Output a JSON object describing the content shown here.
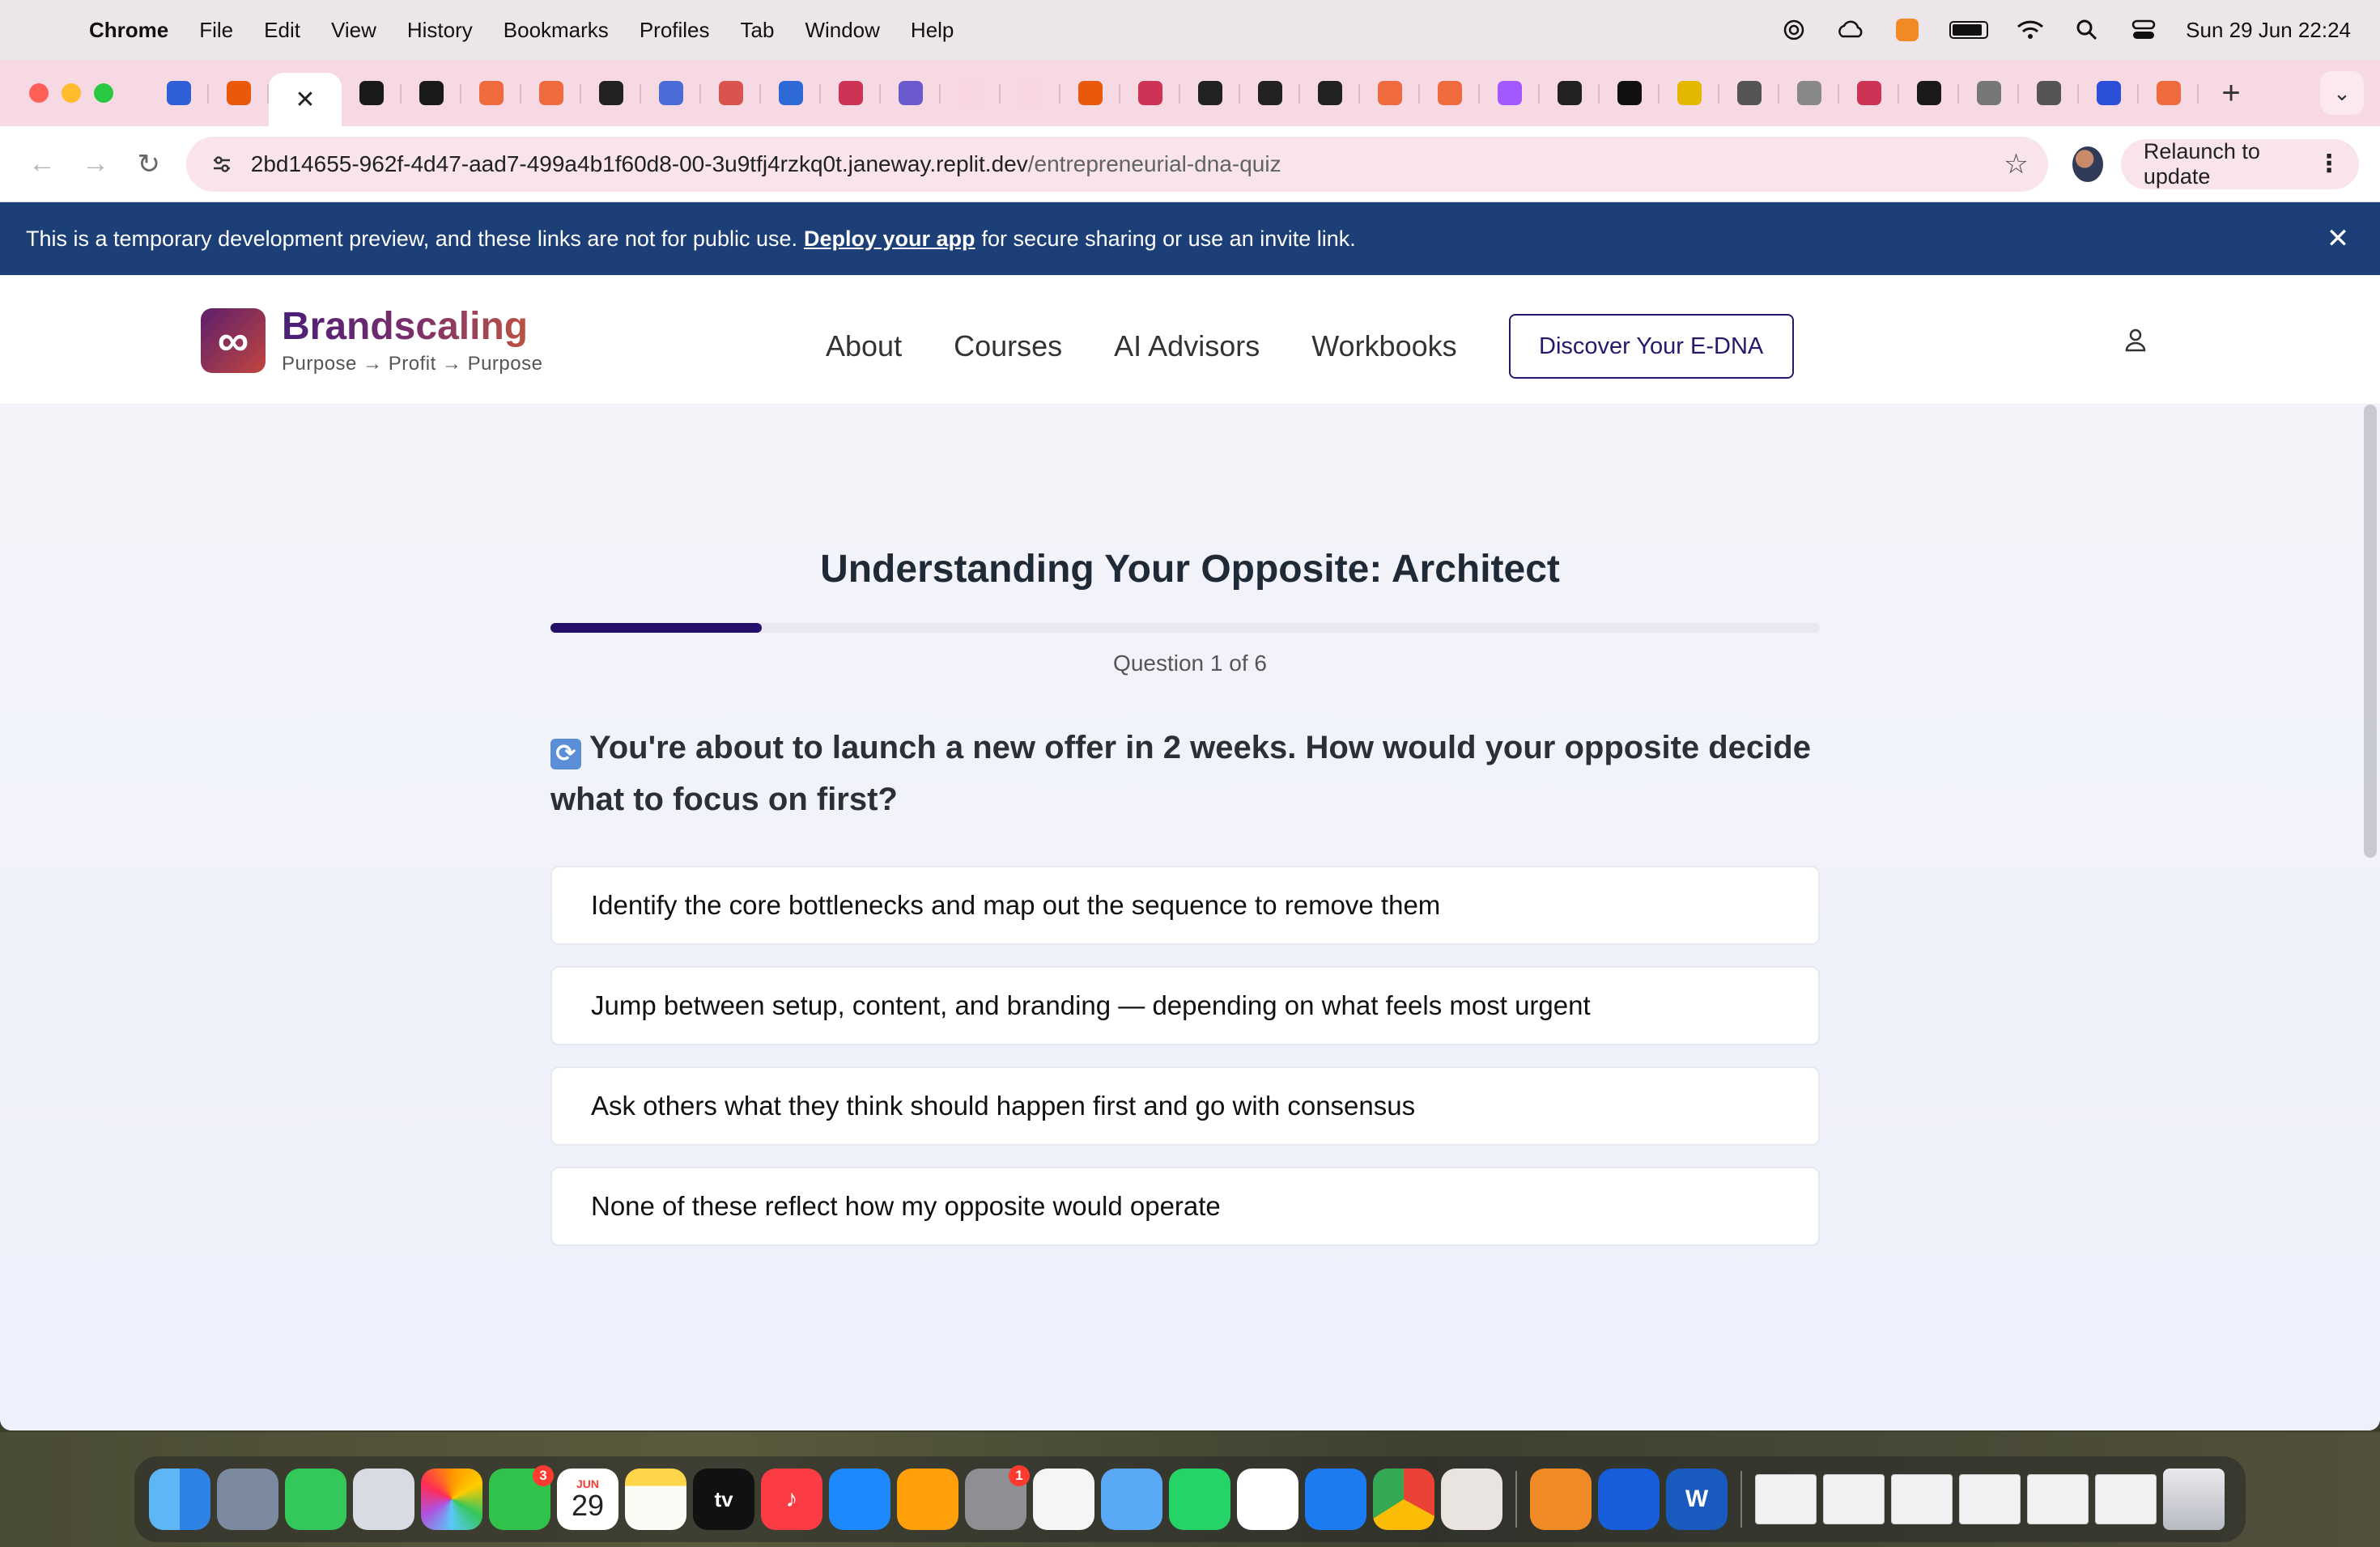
{
  "menubar": {
    "app": "Chrome",
    "items": [
      "File",
      "Edit",
      "View",
      "History",
      "Bookmarks",
      "Profiles",
      "Tab",
      "Window",
      "Help"
    ],
    "clock": "Sun 29 Jun  22:24"
  },
  "tabs": {
    "favicon_colors": [
      "#2f5fd6",
      "#e8590c",
      "#1a1a1a",
      "#1a1a1a",
      "#ef6a3c",
      "#ef6a3c",
      "#222222",
      "#4b6bd6",
      "#d9534f",
      "#2d6ad6",
      "#cc3355",
      "#6a5acd",
      "#f8d7e0",
      "#f8d7e0",
      "#e8590c",
      "#cc3355",
      "#222222",
      "#222222",
      "#222222",
      "#ef6a3c",
      "#ef6a3c",
      "#a259ff",
      "#222222",
      "#111111",
      "#e5b800",
      "#555555",
      "#888888",
      "#cc3355",
      "#1a1a1a",
      "#777777",
      "#555555",
      "#2b4fd6",
      "#ef6a3c"
    ]
  },
  "toolbar": {
    "url_host": "2bd14655-962f-4d47-aad7-499a4b1f60d8-00-3u9tfj4rzkq0t.janeway.replit.dev",
    "url_path": "/entrepreneurial-dna-quiz",
    "relaunch_label": "Relaunch to update"
  },
  "banner": {
    "text_before": "This is a temporary development preview, and these links are not for public use.",
    "link": "Deploy your app",
    "text_after": "for secure sharing or use an invite link."
  },
  "site": {
    "brand": "Brandscaling",
    "tagline": "Purpose → Profit → Purpose",
    "logo_glyph": "∞",
    "nav": [
      "About",
      "Courses",
      "AI Advisors",
      "Workbooks"
    ],
    "cta": "Discover Your E-DNA"
  },
  "quiz": {
    "title": "Understanding Your Opposite: Architect",
    "progress_fraction": 0.1667,
    "counter": "Question 1 of 6",
    "question_icon": "refresh-icon",
    "question": "You're about to launch a new offer in 2 weeks. How would your opposite decide what to focus on first?",
    "options": [
      "Identify the core bottlenecks and map out the sequence to remove them",
      "Jump between setup, content, and branding — depending on what feels most urgent",
      "Ask others what they think should happen first and go with consensus",
      "None of these reflect how my opposite would operate"
    ]
  },
  "dock": {
    "calendar_month": "JUN",
    "calendar_day": "29",
    "facetime_badge": "3",
    "settings_badge": "1",
    "tv_label": "tv"
  },
  "colors": {
    "banner_bg": "#1c3f78",
    "accent": "#24196a",
    "progress": "#24106a"
  }
}
